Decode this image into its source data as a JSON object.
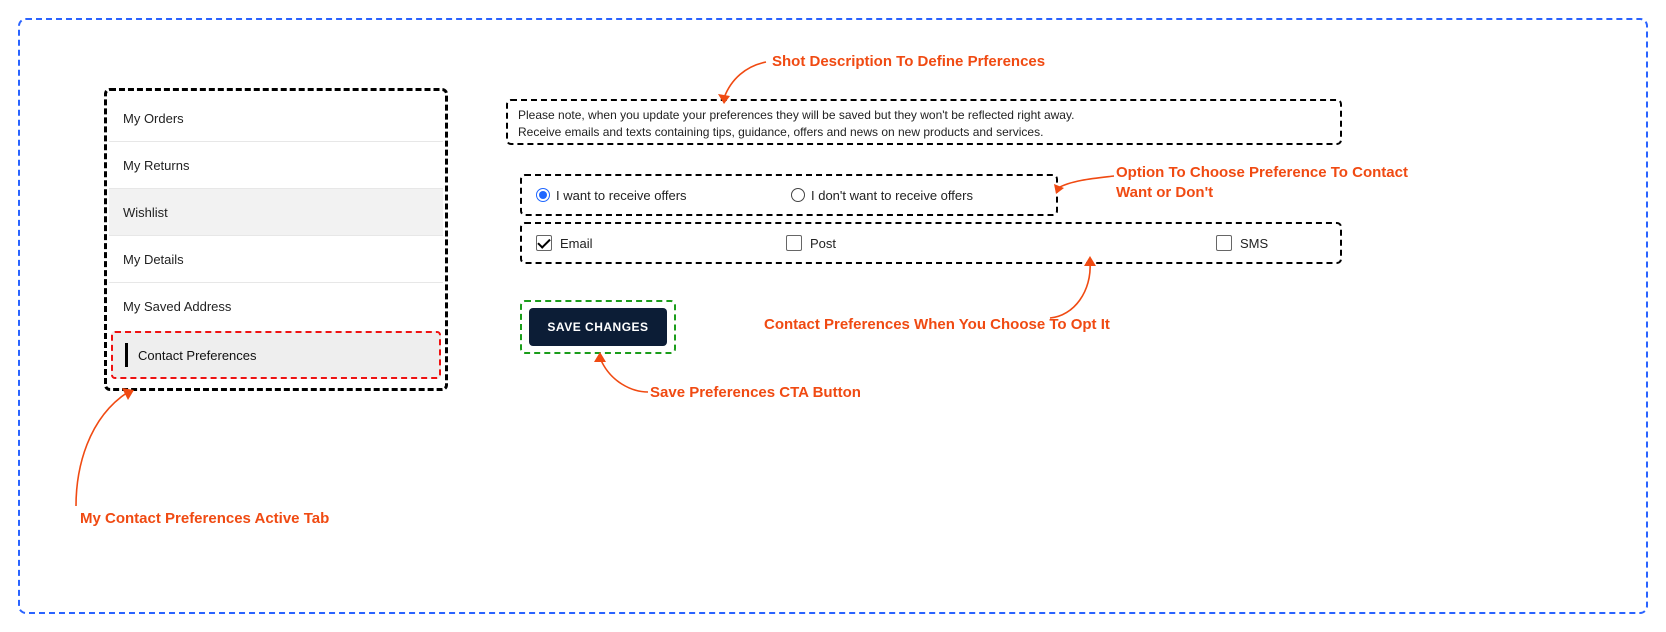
{
  "sidebar": {
    "items": [
      {
        "label": "My Orders"
      },
      {
        "label": "My Returns"
      },
      {
        "label": "Wishlist"
      },
      {
        "label": "My Details"
      },
      {
        "label": "My Saved Address"
      }
    ],
    "active_label": "Contact Preferences"
  },
  "description": {
    "line1": "Please note, when you update your preferences they will be saved but they won't be reflected right away.",
    "line2": "Receive emails and texts containing tips, guidance, offers and news on new products and services."
  },
  "offer_options": {
    "want": "I want to receive offers",
    "dont": "I don't want to receive offers",
    "selected": "want"
  },
  "channels": {
    "email": {
      "label": "Email",
      "checked": true
    },
    "post": {
      "label": "Post",
      "checked": false
    },
    "sms": {
      "label": "SMS",
      "checked": false
    }
  },
  "button_label": "SAVE CHANGES",
  "annotations": {
    "desc": "Shot Description To Define Prferences",
    "tab": "My Contact Preferences Active Tab",
    "options": "Option To Choose Preference To Contact Want or Don't",
    "channels": "Contact Preferences When You Choose To Opt It",
    "button": "Save Preferences CTA Button"
  }
}
